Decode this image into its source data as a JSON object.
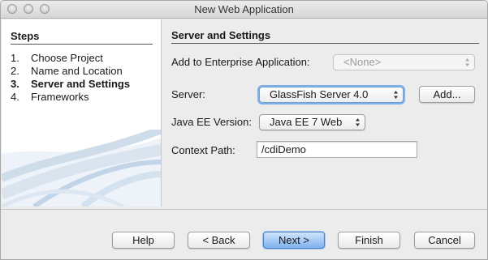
{
  "window": {
    "title": "New Web Application"
  },
  "steps": {
    "heading": "Steps",
    "items": [
      {
        "num": "1.",
        "label": "Choose Project"
      },
      {
        "num": "2.",
        "label": "Name and Location"
      },
      {
        "num": "3.",
        "label": "Server and Settings"
      },
      {
        "num": "4.",
        "label": "Frameworks"
      }
    ],
    "current_index": 2
  },
  "main": {
    "heading": "Server and Settings",
    "enterprise_label": "Add to Enterprise Application:",
    "enterprise_value": "<None>",
    "server_label": "Server:",
    "server_value": "GlassFish Server 4.0",
    "add_button": "Add...",
    "javaee_label": "Java EE Version:",
    "javaee_value": "Java EE 7 Web",
    "context_label": "Context Path:",
    "context_value": "/cdiDemo"
  },
  "buttons": {
    "help": "Help",
    "back": "< Back",
    "next": "Next >",
    "finish": "Finish",
    "cancel": "Cancel"
  },
  "colors": {
    "primary_button": "#7fb2ef",
    "window_bg": "#ececec"
  }
}
